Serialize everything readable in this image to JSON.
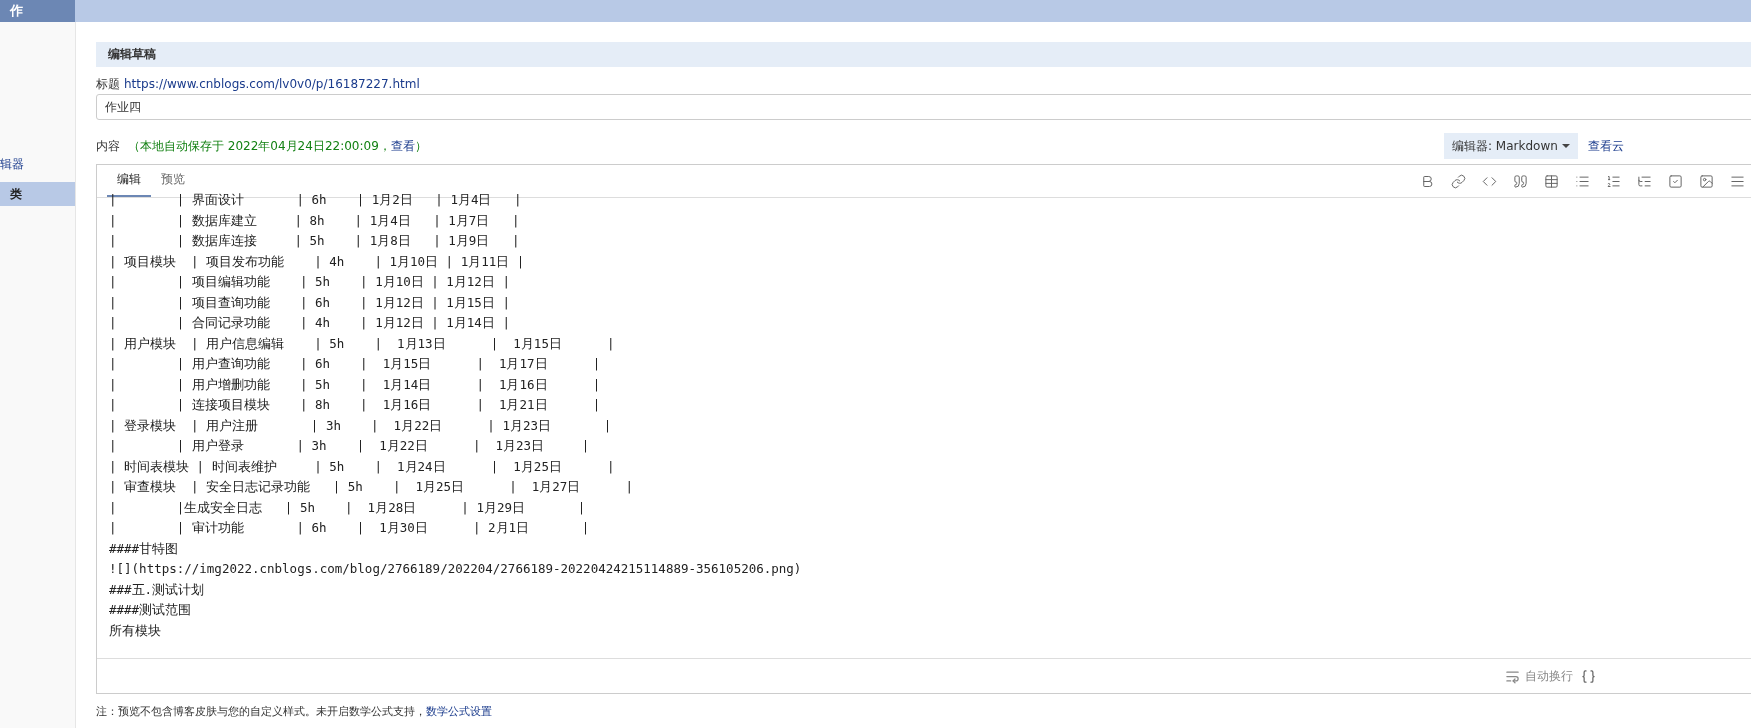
{
  "top_bar": {
    "title": "作"
  },
  "sidebar": {
    "items": [
      {
        "label": "辑器",
        "selected": false
      },
      {
        "label": "类",
        "selected": true
      }
    ]
  },
  "panel": {
    "heading": "编辑草稿"
  },
  "title_field": {
    "label": "标题",
    "link": "https://www.cnblogs.com/lv0v0/p/16187227.html",
    "value": "作业四"
  },
  "content": {
    "label": "内容",
    "autosave": "（本地自动保存于 2022年04月24日22:00:09，",
    "view_link": "查看",
    "autosave_end": "）",
    "editor_select": "编辑器: Markdown",
    "cloud_link": "查看云"
  },
  "editor": {
    "tabs": [
      {
        "label": "编辑",
        "selected": true
      },
      {
        "label": "预览",
        "selected": false
      }
    ],
    "lines": [
      "|        | 界面设计       | 6h    | 1月2日   | 1月4日   |",
      "|        | 数据库建立     | 8h    | 1月4日   | 1月7日   |",
      "|        | 数据库连接     | 5h    | 1月8日   | 1月9日   |",
      "| 项目模块  | 项目发布功能    | 4h    | 1月10日 | 1月11日 |",
      "|        | 项目编辑功能    | 5h    | 1月10日 | 1月12日 |",
      "|        | 项目查询功能    | 6h    | 1月12日 | 1月15日 |",
      "|        | 合同记录功能    | 4h    | 1月12日 | 1月14日 |",
      "| 用户模块  | 用户信息编辑    | 5h    |  1月13日      |  1月15日      |",
      "|        | 用户查询功能    | 6h    |  1月15日      |  1月17日      |",
      "|        | 用户增删功能    | 5h    |  1月14日      |  1月16日      |",
      "|        | 连接项目模块    | 8h    |  1月16日      |  1月21日      |",
      "| 登录模块  | 用户注册       | 3h    |  1月22日      | 1月23日       |",
      "|        | 用户登录       | 3h    |  1月22日      |  1月23日     |",
      "| 时间表模块 | 时间表维护     | 5h    |  1月24日      |  1月25日      |",
      "| 审查模块  | 安全日志记录功能   | 5h    |  1月25日      |  1月27日      |",
      "|        |生成安全日志   | 5h    |  1月28日      | 1月29日       |",
      "|        | 审计功能       | 6h    |  1月30日      | 2月1日       |",
      "####甘特图",
      "![](https://img2022.cnblogs.com/blog/2766189/202204/2766189-20220424215114889-356105206.png)",
      "###五.测试计划",
      "####测试范围",
      "所有模块"
    ],
    "wrap_label": "自动换行"
  },
  "footnote": {
    "text": "注：预览不包含博客皮肤与您的自定义样式。未开启数学公式支持，",
    "link": "数学公式设置"
  }
}
